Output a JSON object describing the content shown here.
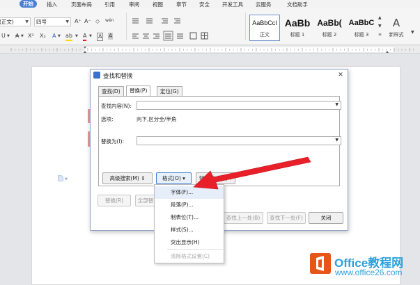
{
  "ribbon": {
    "tabs": [
      "开始",
      "插入",
      "页面布局",
      "引用",
      "审阅",
      "视图",
      "章节",
      "安全",
      "开发工具",
      "云服务",
      "文档助手"
    ],
    "active_tab": "开始"
  },
  "toolbar": {
    "font_name": "(正文)",
    "font_size": "四号",
    "grow_font": "A⁺",
    "shrink_font": "A⁻",
    "clear_format": "◇",
    "phonetic": "wén",
    "underline": "U",
    "strike": "A",
    "superscript": "X²",
    "subscript": "X₂",
    "text_effect": "A",
    "highlight": "ab",
    "font_color": "A",
    "char_border": "A",
    "char_shade": "A",
    "styles": [
      {
        "sample": "AaBbCcI",
        "name": "正文"
      },
      {
        "sample": "AaBb",
        "name": "标题 1"
      },
      {
        "sample": "AaBb(",
        "name": "标题 2"
      },
      {
        "sample": "AaBbC",
        "name": "标题 3"
      }
    ],
    "new_style_label": "新样式",
    "wenzi_label": "文"
  },
  "dialog": {
    "title": "查找和替换",
    "close": "✕",
    "tabs": [
      "查找(D)",
      "替换(P)",
      "定位(G)"
    ],
    "active_tab": "替换(P)",
    "find_label": "查找内容(N):",
    "find_value": "",
    "options_label": "选项:",
    "options_value": "向下,区分全/半角",
    "replace_label": "替换为(I):",
    "replace_value": "",
    "buttons": {
      "advanced": "高级搜索(M) ⇕",
      "format": "格式(O) ▾",
      "special": "特殊格式(E) ▾",
      "replace": "替换(R)",
      "replace_all": "全部替",
      "find_prev": "查找上一处(B)",
      "find_next": "查找下一处(F)",
      "close": "关闭"
    }
  },
  "format_menu": {
    "items": [
      "字体(F)...",
      "段落(P)...",
      "制表位(T)...",
      "样式(S)...",
      "突出显示(H)",
      "清除格式设置(C)"
    ],
    "highlighted": "字体(F)...",
    "disabled": "清除格式设置(C)"
  },
  "watermark": {
    "title": "Office教程网",
    "url": "www.office26.com"
  },
  "colors": {
    "accent": "#4a7fd4",
    "arrow": "#e8202a",
    "watermark": "#2ea0da",
    "logo": "#e8551a"
  }
}
